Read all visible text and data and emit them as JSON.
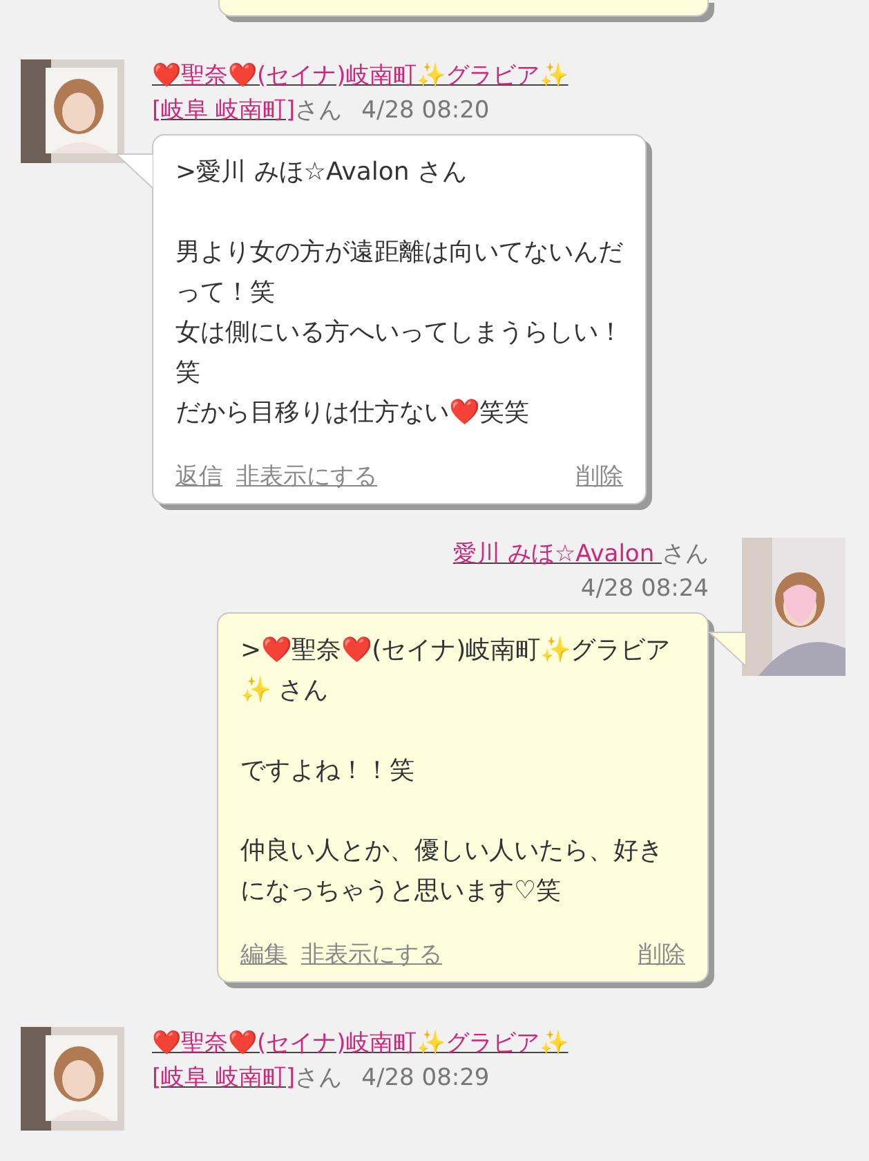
{
  "messages": [
    {
      "kind": "cut"
    },
    {
      "kind": "received",
      "sender": "❤️聖奈❤️(セイナ)岐南町✨グラビア✨",
      "location": "[岐阜 岐南町]",
      "honorific": "さん",
      "time": "4/28 08:20",
      "paragraphs": [
        [
          ">愛川 みほ☆Avalon さん"
        ],
        [
          "男より女の方が遠距離は向いてないんだって！笑",
          "女は側にいる方へいってしまうらしい！笑",
          "だから目移りは仕方ない❤️笑笑"
        ]
      ],
      "actions": [
        {
          "label": "返信"
        },
        {
          "label": "非表示にする"
        }
      ],
      "delete": "削除"
    },
    {
      "kind": "sent",
      "sender": "愛川 みほ☆Avalon ",
      "honorific": "さん",
      "time": "4/28 08:24",
      "paragraphs": [
        [
          ">❤️聖奈❤️(セイナ)岐南町✨グラビア✨ さん"
        ],
        [
          "ですよね！！笑"
        ],
        [
          "仲良い人とか、優しい人いたら、好きになっちゃうと思います♡笑"
        ]
      ],
      "actions": [
        {
          "label": "編集"
        },
        {
          "label": "非表示にする"
        }
      ],
      "delete": "削除"
    },
    {
      "kind": "received_header",
      "sender": "❤️聖奈❤️(セイナ)岐南町✨グラビア✨",
      "location": "[岐阜 岐南町]",
      "honorific": "さん",
      "time": "4/28 08:29"
    }
  ]
}
